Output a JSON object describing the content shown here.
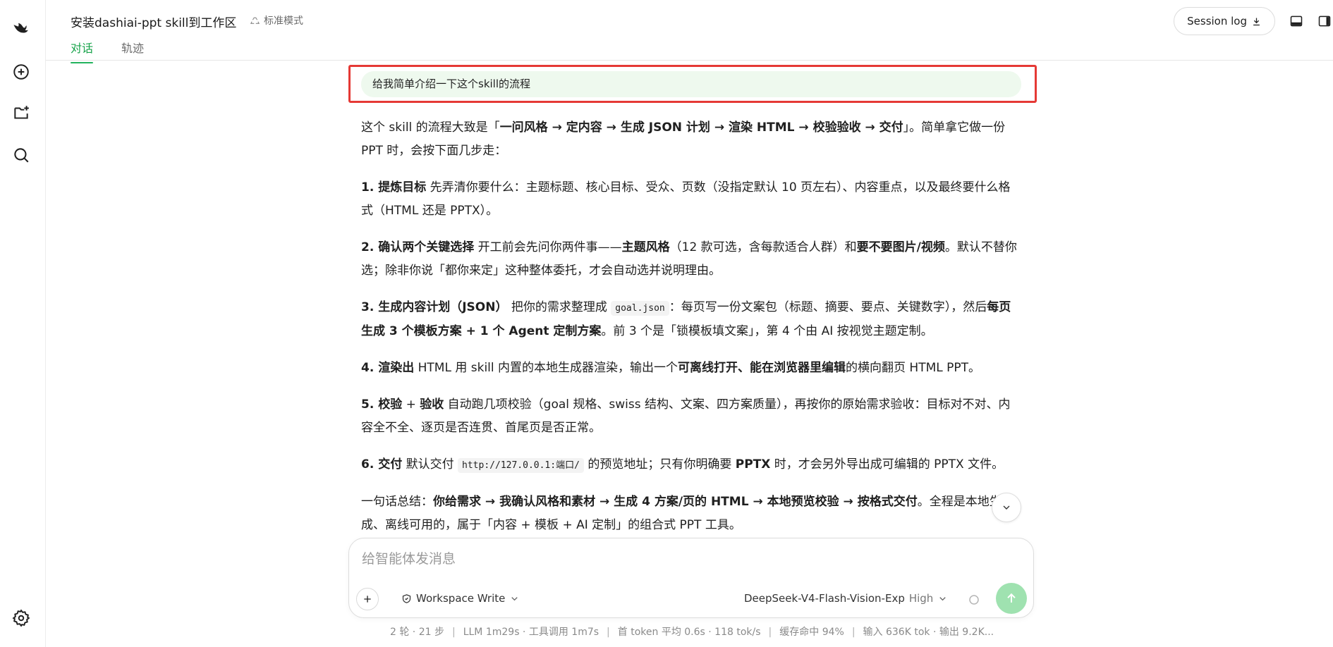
{
  "header": {
    "title": "安装dashiai-ppt skill到工作区",
    "mode_label": "标准模式",
    "tabs": [
      {
        "label": "对话",
        "active": true
      },
      {
        "label": "轨迹",
        "active": false
      }
    ],
    "session_log_label": "Session log"
  },
  "user_message": "给我简单介绍一下这个skill的流程",
  "answer": {
    "intro": {
      "pre": "这个 skill 的流程大致是「",
      "bold": "一问风格 → 定内容 → 生成 JSON 计划 → 渲染 HTML → 校验验收 → 交付",
      "post": "」。简单拿它做一份 PPT 时，会按下面几步走："
    },
    "step1": {
      "num": "1. ",
      "bold": "提炼目标",
      "text": " 先弄清你要什么：主题标题、核心目标、受众、页数（没指定默认 10 页左右）、内容重点，以及最终要什么格式（HTML 还是 PPTX）。"
    },
    "step2": {
      "num": "2. ",
      "bold": "确认两个关键选择",
      "t1": " 开工前会先问你两件事——",
      "b2": "主题风格",
      "t2": "（12 款可选，含每款适合人群）和",
      "b3": "要不要图片/视频",
      "t3": "。默认不替你选；除非你说「都你来定」这种整体委托，才会自动选并说明理由。"
    },
    "step3": {
      "num": "3. ",
      "bold": "生成内容计划（JSON）",
      "t1": " 把你的需求整理成 ",
      "code": "goal.json",
      "t2": "：每页写一份文案包（标题、摘要、要点、关键数字），然后",
      "b2": "每页生成 3 个模板方案 + 1 个 Agent 定制方案",
      "t3": "。前 3 个是「锁模板填文案」，第 4 个由 AI 按视觉主题定制。"
    },
    "step4": {
      "num": "4. ",
      "bold": "渲染出",
      "t1": " HTML 用 skill 内置的本地生成器渲染，输出一个",
      "b2": "可离线打开、能在浏览器里编辑",
      "t2": "的横向翻页 HTML PPT。"
    },
    "step5": {
      "num": "5. ",
      "bold": "校验",
      "t1": " + ",
      "b2": "验收",
      "t2": " 自动跑几项校验（goal 规格、swiss 结构、文案、四方案质量），再按你的原始需求验收：目标对不对、内容全不全、逐页是否连贯、首尾页是否正常。"
    },
    "step6": {
      "num": "6. ",
      "bold": "交付",
      "t1": " 默认交付 ",
      "code": "http://127.0.0.1:端口/",
      "t2": " 的预览地址；只有你明确要 ",
      "b2": "PPTX",
      "t3": " 时，才会另外导出成可编辑的 PPTX 文件。"
    },
    "summary": {
      "pre": "一句话总结：",
      "bold": "你给需求 → 我确认风格和素材 → 生成 4 方案/页的 HTML → 本地预览校验 → 按格式交付",
      "post": "。全程是本地生成、离线可用的，属于「内容 + 模板 + AI 定制」的组合式 PPT 工具。"
    }
  },
  "composer": {
    "placeholder": "给智能体发消息",
    "permission_label": "Workspace Write",
    "model_label": "DeepSeek-V4-Flash-Vision-Exp",
    "reasoning_level": "High"
  },
  "stats": {
    "turns": "2 轮 · 21 步",
    "llm": "LLM 1m29s · 工具调用 1m7s",
    "first_token": "首 token 平均 0.6s · 118 tok/s",
    "cache": "缓存命中 94%",
    "io": "输入 636K tok · 输出 9.2K..."
  },
  "colors": {
    "accent_green": "#17a34a",
    "highlight_red": "#e53935",
    "user_bubble": "#eef9ee",
    "send_button": "#9fe2b0"
  },
  "icons": {
    "rail": [
      "logo-icon",
      "new-chat-icon",
      "new-project-icon",
      "search-icon",
      "settings-icon"
    ],
    "header": [
      "download-icon",
      "panel-bottom-icon",
      "panel-right-icon"
    ]
  }
}
